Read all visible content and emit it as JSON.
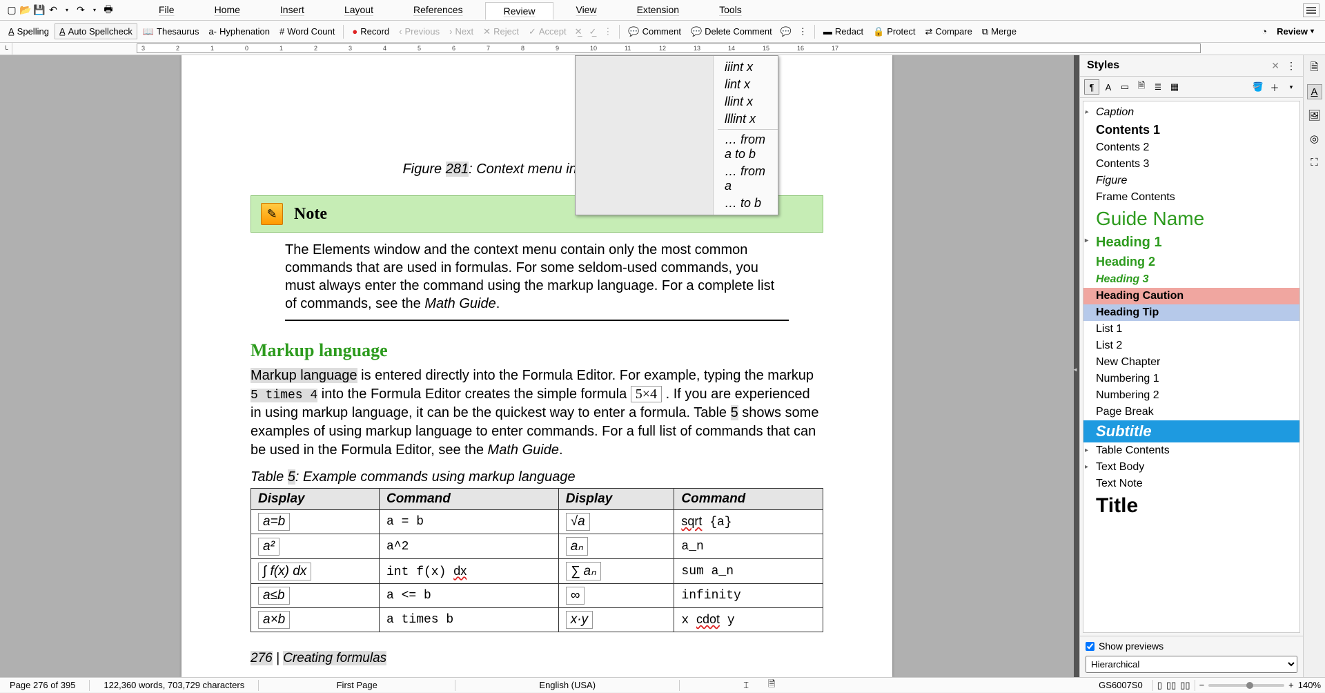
{
  "menubar": {
    "items": [
      "File",
      "Home",
      "Insert",
      "Layout",
      "References",
      "Review",
      "View",
      "Extension",
      "Tools"
    ],
    "active_index": 5
  },
  "toolbar": {
    "spelling": "Spelling",
    "auto_spellcheck": "Auto Spellcheck",
    "thesaurus": "Thesaurus",
    "hyphenation": "Hyphenation",
    "word_count": "Word Count",
    "record": "Record",
    "previous": "Previous",
    "next": "Next",
    "reject": "Reject",
    "accept": "Accept",
    "comment": "Comment",
    "delete_comment": "Delete Comment",
    "redact": "Redact",
    "protect": "Protect",
    "compare": "Compare",
    "merge": "Merge",
    "review": "Review"
  },
  "context_menu": {
    "items": [
      "iiint x",
      "lint x",
      "llint x",
      "lllint x"
    ],
    "sep_items": [
      "… from a to b",
      "… from a",
      "… to b"
    ]
  },
  "figure_caption": {
    "prefix": "Figure ",
    "num": "281",
    "rest": ": Context menu in Formula Editor"
  },
  "note": {
    "title": "Note",
    "body_1": "The Elements window and the context menu contain only the most common commands that are used in formulas. For some seldom-used commands, you must always enter the command using the markup language. For a complete list of commands, see the ",
    "body_math": "Math Guide",
    "body_end": "."
  },
  "heading": "Markup language",
  "para": {
    "p1a": "Markup language",
    "p1b": " is entered directly into the Formula Editor. For example, typing the markup ",
    "code1": "5 times 4",
    "p1c": " into the Formula Editor creates the simple formula ",
    "fmla": "5×4",
    "p1d": " . If you are experienced in using markup language, it can be the quickest way to enter a formula. Table ",
    "tnum": "5",
    "p1e": " shows some examples of using markup language to enter commands. For a full list of commands that can be used in the Formula Editor, see the ",
    "mg": "Math Guide",
    "p1f": "."
  },
  "table_caption": {
    "prefix": "Table ",
    "num": "5",
    "rest": ": Example commands using markup language"
  },
  "table": {
    "headers": [
      "Display",
      "Command",
      "Display",
      "Command"
    ],
    "rows": [
      {
        "d1": "a=b",
        "c1": "a = b",
        "d2": "√a",
        "c2": "sqrt {a}",
        "c2_red": "sqrt"
      },
      {
        "d1": "a²",
        "c1": "a^2",
        "d2": "aₙ",
        "c2": "a_n"
      },
      {
        "d1": "∫ f(x) dx",
        "c1": "int f(x) dx",
        "c1_red": "dx",
        "d2": "∑ aₙ",
        "c2": "sum a_n"
      },
      {
        "d1": "a≤b",
        "c1": "a <= b",
        "d2": "∞",
        "c2": "infinity"
      },
      {
        "d1": "a×b",
        "c1": "a times b",
        "d2": "x·y",
        "c2": "x cdot y",
        "c2_red": "cdot"
      }
    ]
  },
  "page_footer": {
    "num": "276",
    "sep": " | ",
    "title": "Creating formulas"
  },
  "styles": {
    "title": "Styles",
    "items": [
      {
        "label": "Caption",
        "cls": "s-caption",
        "exp": true
      },
      {
        "label": "Contents 1",
        "cls": "s-contents1"
      },
      {
        "label": "Contents 2",
        "cls": ""
      },
      {
        "label": "Contents 3",
        "cls": ""
      },
      {
        "label": "Figure",
        "cls": "s-figure"
      },
      {
        "label": "Frame Contents",
        "cls": "s-frame"
      },
      {
        "label": "Guide Name",
        "cls": "s-guide"
      },
      {
        "label": "Heading 1",
        "cls": "s-h1",
        "exp": true
      },
      {
        "label": "Heading 2",
        "cls": "s-h2"
      },
      {
        "label": "Heading 3",
        "cls": "s-h3"
      },
      {
        "label": "Heading Caution",
        "cls": "s-caution"
      },
      {
        "label": "Heading Tip",
        "cls": "s-tip"
      },
      {
        "label": "List 1",
        "cls": ""
      },
      {
        "label": "List 2",
        "cls": ""
      },
      {
        "label": "New Chapter",
        "cls": ""
      },
      {
        "label": "Numbering 1",
        "cls": ""
      },
      {
        "label": "Numbering 2",
        "cls": ""
      },
      {
        "label": "Page Break",
        "cls": "s-pagebreak"
      },
      {
        "label": "Subtitle",
        "cls": "s-subtitle"
      },
      {
        "label": "Table Contents",
        "cls": "",
        "exp": true
      },
      {
        "label": "Text Body",
        "cls": "",
        "exp": true
      },
      {
        "label": "Text Note",
        "cls": ""
      },
      {
        "label": "Title",
        "cls": "s-title"
      }
    ],
    "show_previews": "Show previews",
    "filter": "Hierarchical"
  },
  "statusbar": {
    "page": "Page 276 of 395",
    "words": "122,360 words, 703,729 characters",
    "style": "First Page",
    "lang": "English (USA)",
    "code": "GS6007S0",
    "zoom": "140%"
  }
}
